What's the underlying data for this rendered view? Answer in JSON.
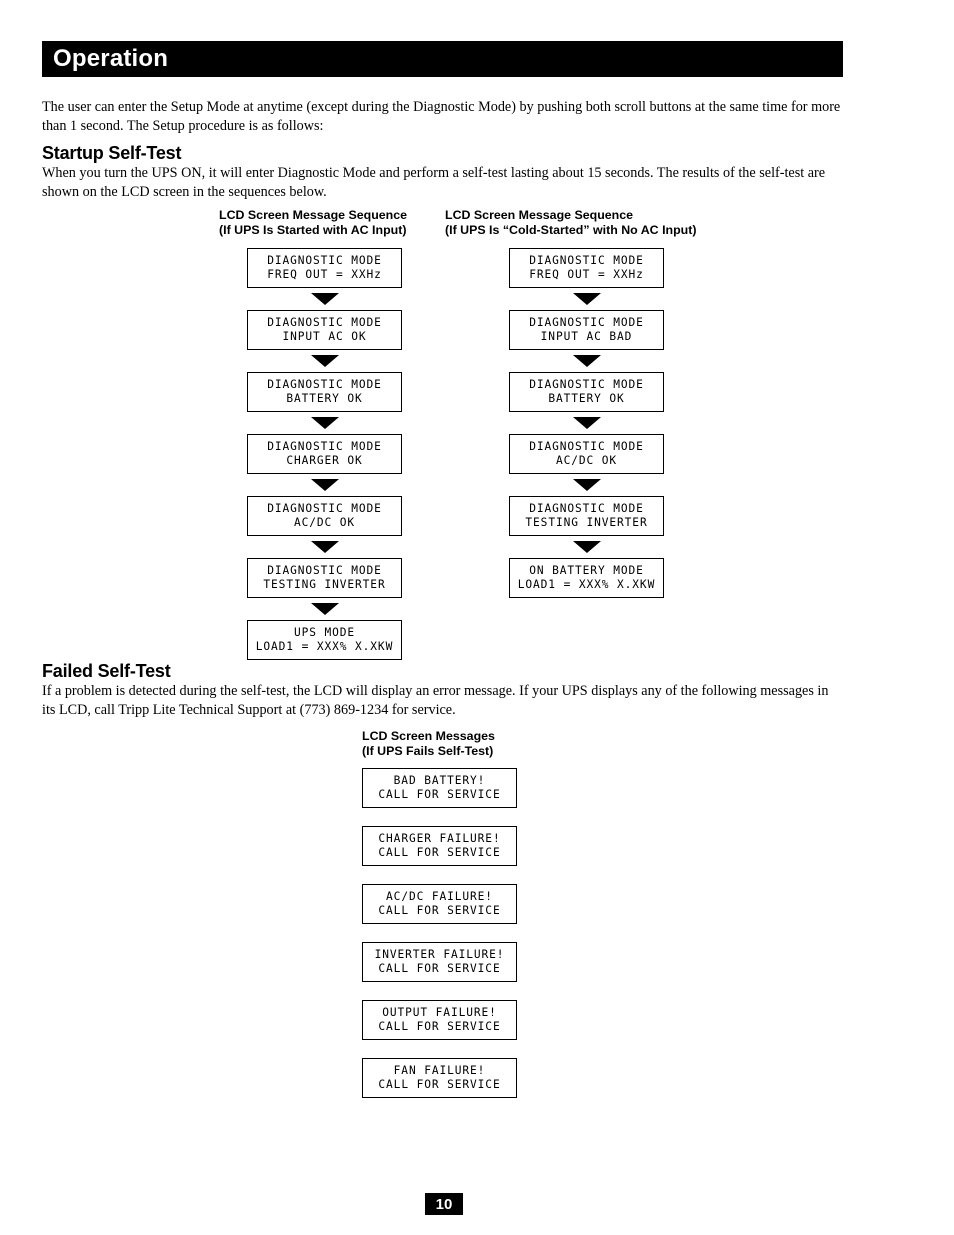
{
  "header": {
    "title": "Operation"
  },
  "intro_paragraph": "The user can enter the Setup Mode at anytime (except during the Diagnostic Mode) by pushing both scroll buttons at the same time for more than 1 second. The Setup procedure is as follows:",
  "startup_section": {
    "heading": "Startup Self-Test",
    "paragraph": "When you turn the UPS ON, it will enter Diagnostic Mode and perform a self-test lasting about 15 seconds. The results of the self-test are shown on the LCD screen in the sequences below.",
    "left_column": {
      "caption": "LCD Screen Message Sequence\n(If UPS Is Started with AC Input)",
      "screens": [
        {
          "line1": "DIAGNOSTIC MODE",
          "line2": "FREQ OUT = XXHz"
        },
        {
          "line1": "DIAGNOSTIC MODE",
          "line2": "INPUT AC OK"
        },
        {
          "line1": "DIAGNOSTIC MODE",
          "line2": "BATTERY OK"
        },
        {
          "line1": "DIAGNOSTIC MODE",
          "line2": "CHARGER OK"
        },
        {
          "line1": "DIAGNOSTIC MODE",
          "line2": "AC/DC OK"
        },
        {
          "line1": "DIAGNOSTIC MODE",
          "line2": "TESTING INVERTER"
        },
        {
          "line1": "UPS MODE",
          "line2": "LOAD1 = XXX% X.XKW"
        }
      ]
    },
    "right_column": {
      "caption": "LCD Screen Message Sequence\n(If UPS Is “Cold-Started” with No AC Input)",
      "screens": [
        {
          "line1": "DIAGNOSTIC MODE",
          "line2": "FREQ OUT = XXHz"
        },
        {
          "line1": "DIAGNOSTIC MODE",
          "line2": "INPUT AC BAD"
        },
        {
          "line1": "DIAGNOSTIC MODE",
          "line2": "BATTERY OK"
        },
        {
          "line1": "DIAGNOSTIC MODE",
          "line2": "AC/DC OK"
        },
        {
          "line1": "DIAGNOSTIC MODE",
          "line2": "TESTING INVERTER"
        },
        {
          "line1": "ON BATTERY MODE",
          "line2": "LOAD1 = XXX% X.XKW"
        }
      ]
    }
  },
  "failed_section": {
    "heading": "Failed Self-Test",
    "paragraph": "If a problem is detected during the self-test, the LCD will display an error message. If your UPS displays any of the following messages in its LCD, call Tripp Lite Technical Support at (773) 869-1234 for service.",
    "caption": "LCD Screen Messages\n(If UPS Fails Self-Test)",
    "screens": [
      {
        "line1": "BAD BATTERY!",
        "line2": "CALL FOR SERVICE"
      },
      {
        "line1": "CHARGER FAILURE!",
        "line2": "CALL FOR SERVICE"
      },
      {
        "line1": "AC/DC FAILURE!",
        "line2": "CALL FOR SERVICE"
      },
      {
        "line1": "INVERTER FAILURE!",
        "line2": "CALL FOR SERVICE"
      },
      {
        "line1": "OUTPUT FAILURE!",
        "line2": "CALL FOR SERVICE"
      },
      {
        "line1": "FAN FAILURE!",
        "line2": "CALL FOR SERVICE"
      }
    ]
  },
  "footer": {
    "page_number": "10"
  }
}
